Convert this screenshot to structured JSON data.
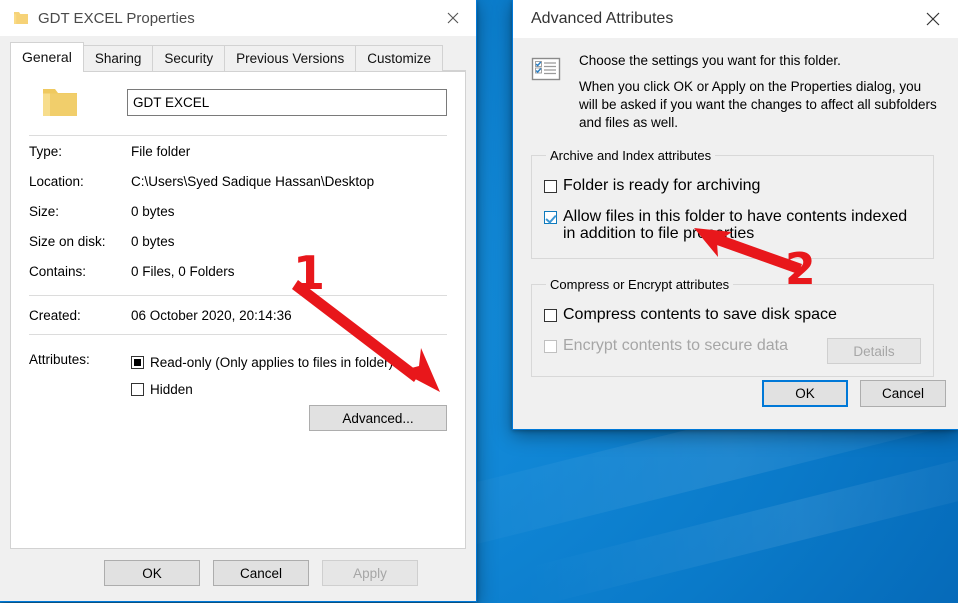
{
  "desktop": {
    "background_color": "#0d85d4"
  },
  "properties_dialog": {
    "title": "GDT EXCEL Properties",
    "title_icon": "folder-icon",
    "close_icon": "close-icon",
    "tabs": [
      {
        "label": "General",
        "active": true
      },
      {
        "label": "Sharing",
        "active": false
      },
      {
        "label": "Security",
        "active": false
      },
      {
        "label": "Previous Versions",
        "active": false
      },
      {
        "label": "Customize",
        "active": false
      }
    ],
    "folder_icon": "folder-icon",
    "name_field": {
      "value": "GDT EXCEL",
      "placeholder": "Folder name"
    },
    "info_rows": [
      {
        "label": "Type:",
        "value": "File folder"
      },
      {
        "label": "Location:",
        "value": "C:\\Users\\Syed Sadique Hassan\\Desktop"
      },
      {
        "label": "Size:",
        "value": "0 bytes"
      },
      {
        "label": "Size on disk:",
        "value": "0 bytes"
      },
      {
        "label": "Contains:",
        "value": "0 Files, 0 Folders"
      }
    ],
    "created_row": {
      "label": "Created:",
      "value": "06 October 2020, 20:14:36"
    },
    "attributes": {
      "label": "Attributes:",
      "read_only": {
        "label": "Read-only (Only applies to files in folder)",
        "state": "indeterminate"
      },
      "hidden": {
        "label": "Hidden",
        "state": "unchecked"
      },
      "advanced_button": "Advanced..."
    },
    "footer": {
      "ok": "OK",
      "cancel": "Cancel",
      "apply": "Apply",
      "apply_disabled": true
    }
  },
  "advanced_dialog": {
    "title": "Advanced Attributes",
    "close_icon": "close-icon",
    "info_icon": "checklist-icon",
    "intro_line_1": "Choose the settings you want for this folder.",
    "intro_line_2": "When you click OK or Apply on the Properties dialog, you will be asked if you want the changes to affect all subfolders and files as well.",
    "archive_group": {
      "legend": "Archive and Index attributes",
      "archive_ready": {
        "label": "Folder is ready for archiving",
        "state": "unchecked"
      },
      "index_contents": {
        "label": "Allow files in this folder to have contents indexed in addition to file properties",
        "state": "checked"
      }
    },
    "compress_group": {
      "legend": "Compress or Encrypt attributes",
      "compress": {
        "label": "Compress contents to save disk space",
        "state": "unchecked",
        "disabled": false
      },
      "encrypt": {
        "label": "Encrypt contents to secure data",
        "state": "unchecked",
        "disabled": true
      },
      "details_button": {
        "label": "Details",
        "disabled": true
      }
    },
    "footer": {
      "ok": "OK",
      "cancel": "Cancel"
    }
  },
  "annotations": {
    "color": "#e8171b",
    "marker_1": {
      "number": "1",
      "description": "arrow pointing to Advanced button"
    },
    "marker_2": {
      "number": "2",
      "description": "arrow pointing to indexing checkbox"
    }
  }
}
